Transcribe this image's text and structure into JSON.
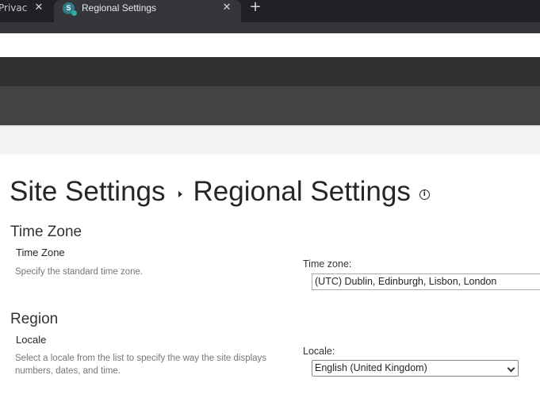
{
  "browser": {
    "tabs": [
      {
        "title": "Privacy",
        "close": "✕"
      },
      {
        "title": "Regional Settings",
        "close": "✕",
        "favicon_letter": "S"
      }
    ],
    "new_tab": "+"
  },
  "page": {
    "breadcrumb_parent": "Site Settings",
    "title": "Regional Settings",
    "info_icon": "i"
  },
  "sections": {
    "time_zone": {
      "heading": "Time Zone",
      "field_title": "Time Zone",
      "description": "Specify the standard time zone.",
      "control_label": "Time zone:",
      "selected": "(UTC) Dublin, Edinburgh, Lisbon, London"
    },
    "region": {
      "heading": "Region",
      "field_title": "Locale",
      "description": "Select a locale from the list to specify the way the site displays numbers, dates, and time.",
      "control_label": "Locale:",
      "selected": "English (United Kingdom)"
    }
  },
  "colors": {
    "tabstrip": "#202124",
    "active_tab": "#35363a",
    "suite_bar": "#303030",
    "ribbon": "#444444",
    "accent_favicon": "#2d7e89"
  }
}
